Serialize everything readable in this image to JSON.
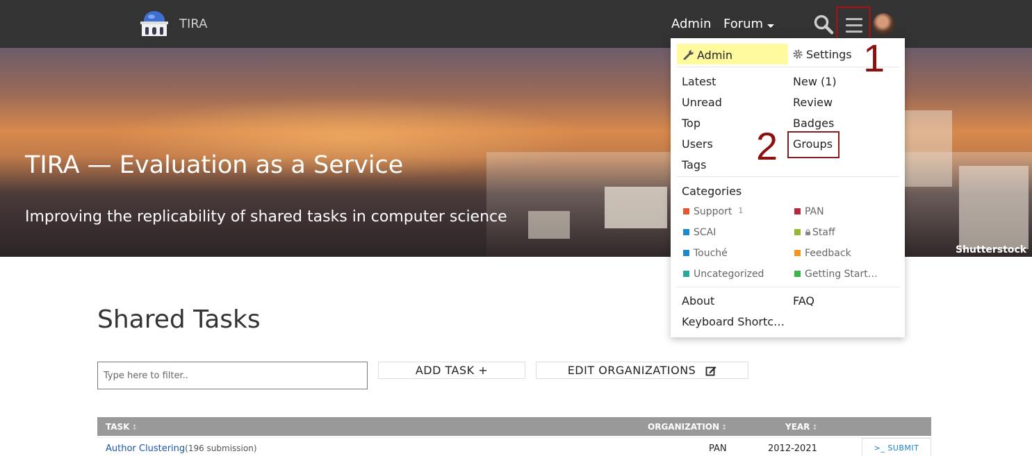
{
  "topbar": {
    "brand": "TIRA",
    "nav": [
      {
        "label": "Admin"
      },
      {
        "label": "Forum"
      }
    ]
  },
  "hero": {
    "title": "TIRA — Evaluation as a Service",
    "subtitle": "Improving the replicability of shared tasks in computer science",
    "credit": "Shutterstock"
  },
  "menu": {
    "admin": "Admin",
    "settings": "Settings",
    "links": [
      "Latest",
      "New (1)",
      "Unread",
      "Review",
      "Top",
      "Badges",
      "Users",
      "Groups",
      "Tags"
    ],
    "categories_heading": "Categories",
    "categories": [
      {
        "label": "Support",
        "count": "1",
        "color": "#e45735"
      },
      {
        "label": "PAN",
        "color": "#b3283b"
      },
      {
        "label": "SCAI",
        "color": "#1e88c9"
      },
      {
        "label": "Staff",
        "color": "#95b833",
        "locked": true
      },
      {
        "label": "Touché",
        "color": "#1e88c9"
      },
      {
        "label": "Feedback",
        "color": "#f7941d"
      },
      {
        "label": "Uncategorized",
        "color": "#2fa69a"
      },
      {
        "label": "Getting Start…",
        "color": "#3ab54a"
      }
    ],
    "footer": [
      "About",
      "FAQ",
      "Keyboard Shortc…"
    ]
  },
  "annotations": {
    "one": "1",
    "two": "2"
  },
  "main": {
    "title": "Shared Tasks",
    "filter_placeholder": "Type here to filter..",
    "add_task": "ADD TASK +",
    "edit_orgs": "EDIT ORGANIZATIONS"
  },
  "table": {
    "headers": {
      "task": "TASK",
      "organization": "ORGANIZATION",
      "year": "YEAR",
      "sort": "↕"
    },
    "rows": [
      {
        "task": "Author Clustering",
        "submissions": "(196 submission)",
        "org": "PAN",
        "year": "2012-2021",
        "action": ">_ SUBMIT"
      }
    ]
  }
}
